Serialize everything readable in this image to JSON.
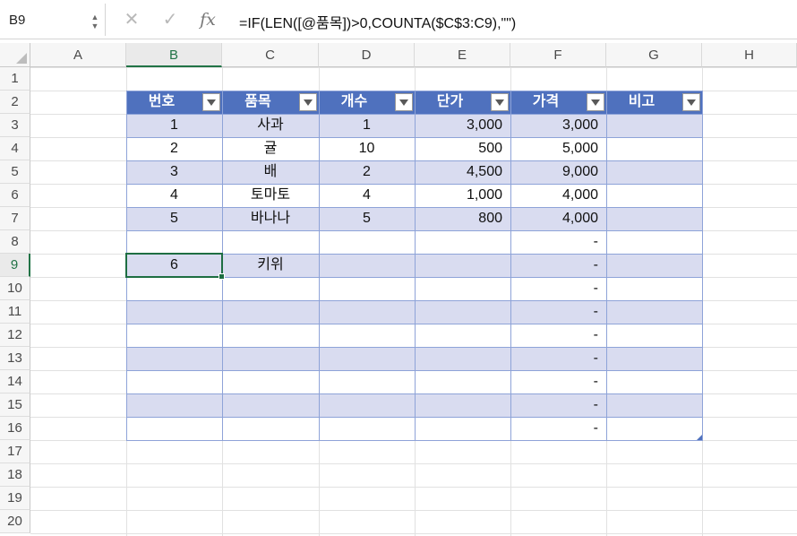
{
  "formula_bar": {
    "name_box": "B9",
    "cancel_icon": "close-icon",
    "enter_icon": "check-icon",
    "fx_label": "fx",
    "formula": "=IF(LEN([@품목])>0,COUNTA($C$3:C9),\"\")"
  },
  "columns": [
    "A",
    "B",
    "C",
    "D",
    "E",
    "F",
    "G",
    "H"
  ],
  "rows": [
    "1",
    "2",
    "3",
    "4",
    "5",
    "6",
    "7",
    "8",
    "9",
    "10",
    "11",
    "12",
    "13",
    "14",
    "15",
    "16",
    "17",
    "18",
    "19",
    "20"
  ],
  "active_cell": {
    "column": "B",
    "row": "9"
  },
  "table": {
    "headers": [
      "번호",
      "품목",
      "개수",
      "단가",
      "가격",
      "비고"
    ],
    "header_color": "#4f71be",
    "band_color": "#d9dcf0",
    "rows": [
      [
        "1",
        "사과",
        "1",
        "3,000",
        "3,000",
        ""
      ],
      [
        "2",
        "귤",
        "10",
        "500",
        "5,000",
        ""
      ],
      [
        "3",
        "배",
        "2",
        "4,500",
        "9,000",
        ""
      ],
      [
        "4",
        "토마토",
        "4",
        "1,000",
        "4,000",
        ""
      ],
      [
        "5",
        "바나나",
        "5",
        "800",
        "4,000",
        ""
      ],
      [
        "",
        "",
        "",
        "",
        "-",
        ""
      ],
      [
        "6",
        "키위",
        "",
        "",
        "-",
        ""
      ],
      [
        "",
        "",
        "",
        "",
        "-",
        ""
      ],
      [
        "",
        "",
        "",
        "",
        "-",
        ""
      ],
      [
        "",
        "",
        "",
        "",
        "-",
        ""
      ],
      [
        "",
        "",
        "",
        "",
        "-",
        ""
      ],
      [
        "",
        "",
        "",
        "",
        "-",
        ""
      ],
      [
        "",
        "",
        "",
        "",
        "-",
        ""
      ],
      [
        "",
        "",
        "",
        "",
        "-",
        ""
      ]
    ]
  }
}
